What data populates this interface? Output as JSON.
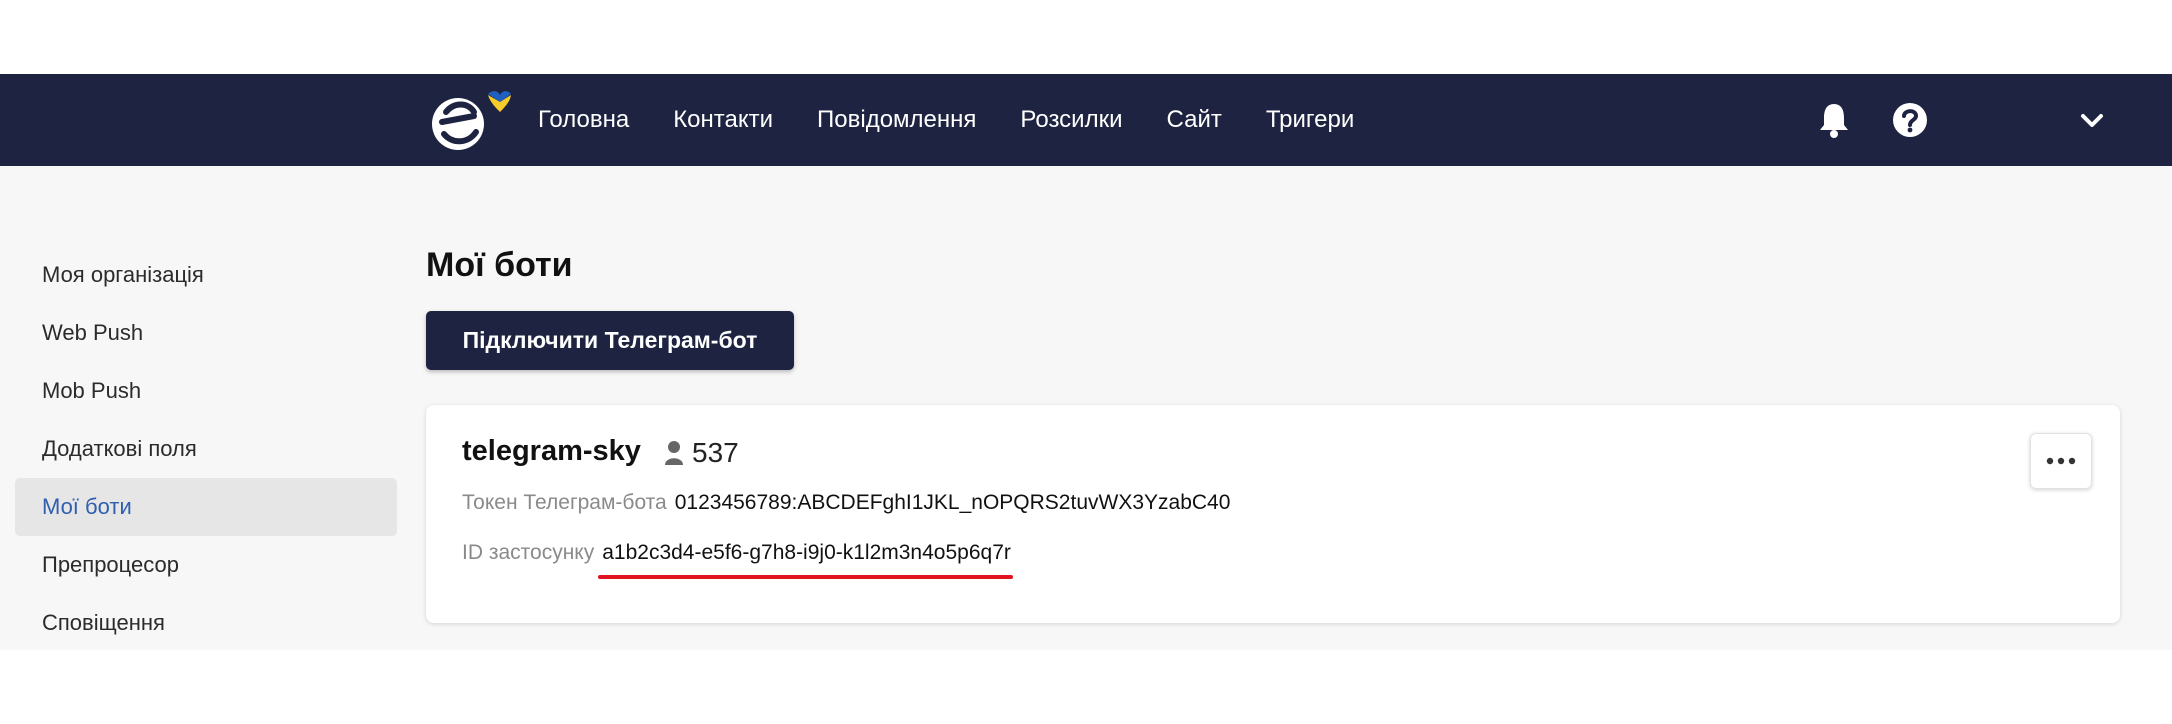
{
  "nav": {
    "items": [
      "Головна",
      "Контакти",
      "Повідомлення",
      "Розсилки",
      "Сайт",
      "Тригери"
    ]
  },
  "icons": {
    "logo": "logo-icon",
    "bell": "bell-icon",
    "help": "question-circle-icon",
    "chevron": "chevron-down-icon",
    "person": "person-icon",
    "more": "more-dots-icon"
  },
  "colors": {
    "topbar": "#1d2340",
    "active_link": "#2f5fae",
    "highlight": "#e0141e",
    "flag_blue": "#1f5fc0",
    "flag_yellow": "#f5cc2a"
  },
  "sidebar": {
    "items": [
      "Моя організація",
      "Web Push",
      "Mob Push",
      "Додаткові поля",
      "Мої боти",
      "Препроцесор",
      "Сповіщення"
    ],
    "active": "Мої боти"
  },
  "main": {
    "title": "Мої боти",
    "connect_button": "Підключити Телеграм-бот"
  },
  "bot": {
    "name": "telegram-sky",
    "subscribers": "537",
    "token_label": "Токен Телеграм-бота",
    "token_value": "0123456789:ABCDEFghI1JKL_nOPQRS2tuvWX3YzabC40",
    "app_id_label": "ID застосунку",
    "app_id_value": "a1b2c3d4-e5f6-g7h8-i9j0-k1l2m3n4o5p6q7r"
  }
}
